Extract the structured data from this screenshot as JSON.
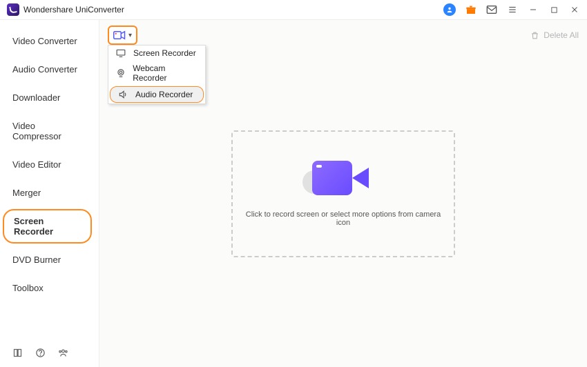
{
  "app": {
    "title": "Wondershare UniConverter"
  },
  "sidebar": {
    "items": [
      {
        "label": "Video Converter"
      },
      {
        "label": "Audio Converter"
      },
      {
        "label": "Downloader"
      },
      {
        "label": "Video Compressor"
      },
      {
        "label": "Video Editor"
      },
      {
        "label": "Merger"
      },
      {
        "label": "Screen Recorder",
        "active": true
      },
      {
        "label": "DVD Burner"
      },
      {
        "label": "Toolbox"
      }
    ]
  },
  "toolbar": {
    "delete_all": "Delete All"
  },
  "dropdown": {
    "items": [
      {
        "label": "Screen Recorder"
      },
      {
        "label": "Webcam Recorder"
      },
      {
        "label": "Audio Recorder",
        "selected": true
      }
    ]
  },
  "dropzone": {
    "hint": "Click to record screen or select more options from camera icon"
  }
}
